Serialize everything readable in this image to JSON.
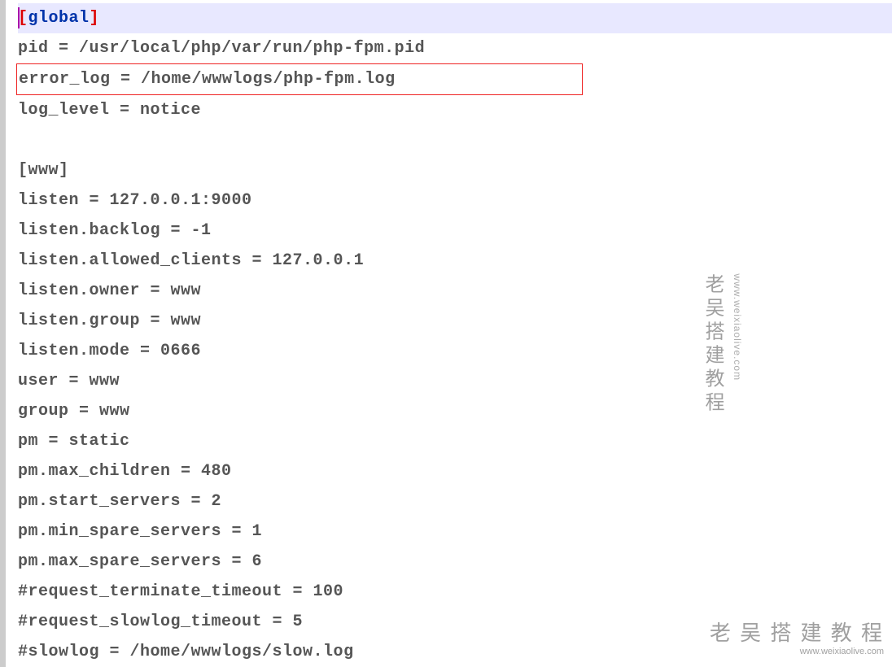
{
  "config": {
    "global_section": "global",
    "global_lines": [
      "pid = /usr/local/php/var/run/php-fpm.pid",
      "error_log = /home/wwwlogs/php-fpm.log",
      "log_level = notice"
    ],
    "www_section": "www",
    "www_lines": [
      "listen = 127.0.0.1:9000",
      "listen.backlog = -1",
      "listen.allowed_clients = 127.0.0.1",
      "listen.owner = www",
      "listen.group = www",
      "listen.mode = 0666",
      "user = www",
      "group = www",
      "pm = static",
      "pm.max_children = 480",
      "pm.start_servers = 2",
      "pm.min_spare_servers = 1",
      "pm.max_spare_servers = 6",
      "#request_terminate_timeout = 100",
      "#request_slowlog_timeout = 5",
      "#slowlog = /home/wwwlogs/slow.log"
    ]
  },
  "watermark": {
    "bottom": "老 吴 搭 建 教 程",
    "right_cn": "老吴搭建教程",
    "right_url": "www.weixiaolive.com",
    "bottom_url_suffix": "www.weixiaolive.com"
  }
}
